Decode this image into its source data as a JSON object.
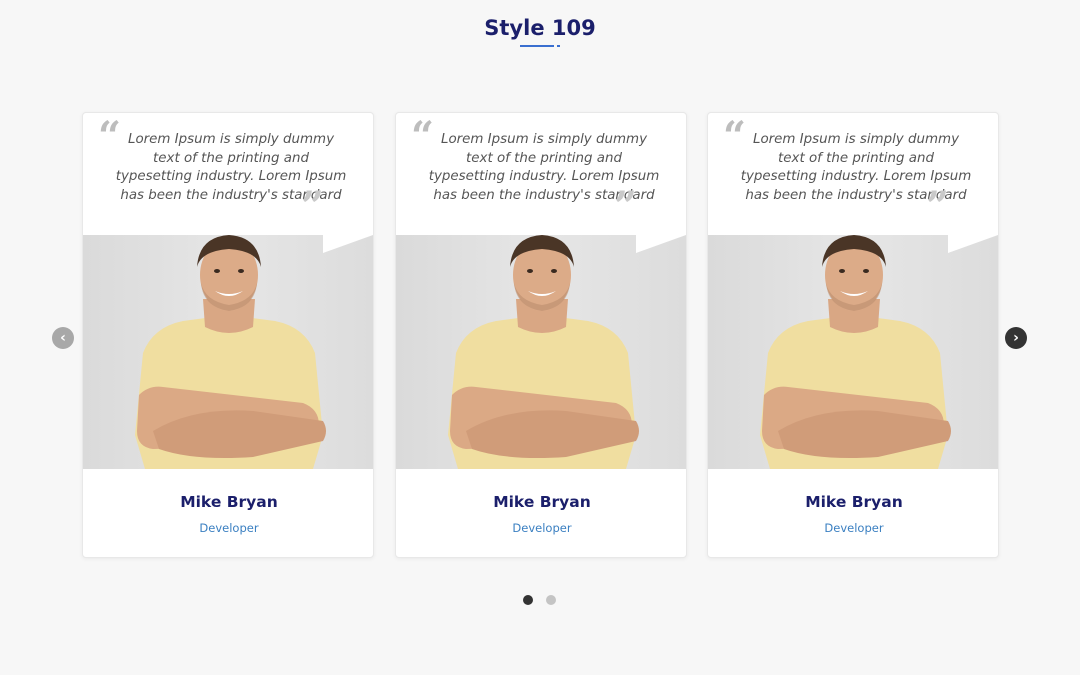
{
  "page": {
    "title": "Style 109",
    "colors": {
      "title": "#1b1f6b",
      "role": "#3a7fc1",
      "accent": "#3a6fd0"
    }
  },
  "testimonials": [
    {
      "quote": "Lorem Ipsum is simply dummy text of the printing and typesetting industry. Lorem Ipsum has been the industry's standard",
      "name": "Mike Bryan",
      "role": "Developer"
    },
    {
      "quote": "Lorem Ipsum is simply dummy text of the printing and typesetting industry. Lorem Ipsum has been the industry's standard",
      "name": "Mike Bryan",
      "role": "Developer"
    },
    {
      "quote": "Lorem Ipsum is simply dummy text of the printing and typesetting industry. Lorem Ipsum has been the industry's standard",
      "name": "Mike Bryan",
      "role": "Developer"
    }
  ],
  "icons": {
    "quote_open": "“",
    "quote_close": "”",
    "prev": "‹",
    "next": "›"
  },
  "pagination": {
    "pages": 2,
    "active": 1
  }
}
